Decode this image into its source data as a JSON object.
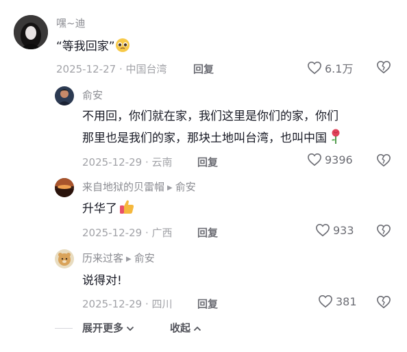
{
  "comments": [
    {
      "author": "嘿~迪",
      "text_lines": [
        "“等我回家”"
      ],
      "date": "2025-12-27",
      "location": "中国台湾",
      "reply_label": "回复",
      "likes": "6.1万"
    },
    {
      "author": "俞安",
      "text_lines": [
        "不用回，你们就在家，我们这里是你们的家，你们",
        "那里也是我们的家，那块土地叫台湾，也叫中国"
      ],
      "date": "2025-12-29",
      "location": "云南",
      "reply_label": "回复",
      "likes": "9396"
    },
    {
      "author": "来自地狱的贝雷帽",
      "reply_to": "俞安",
      "text_lines": [
        "升华了"
      ],
      "date": "2025-12-29",
      "location": "广西",
      "reply_label": "回复",
      "likes": "933"
    },
    {
      "author": "历来过客",
      "reply_to": "俞安",
      "text_lines": [
        "说得对!"
      ],
      "date": "2025-12-29",
      "location": "四川",
      "reply_label": "回复",
      "likes": "381"
    }
  ],
  "meta_separator": " · ",
  "footer": {
    "expand_label": "展开更多",
    "collapse_label": "收起"
  },
  "colors": {
    "text": "#161823",
    "secondary": "#8a8b91",
    "rose": "#e0445a",
    "thumb": "#f5b83d"
  }
}
